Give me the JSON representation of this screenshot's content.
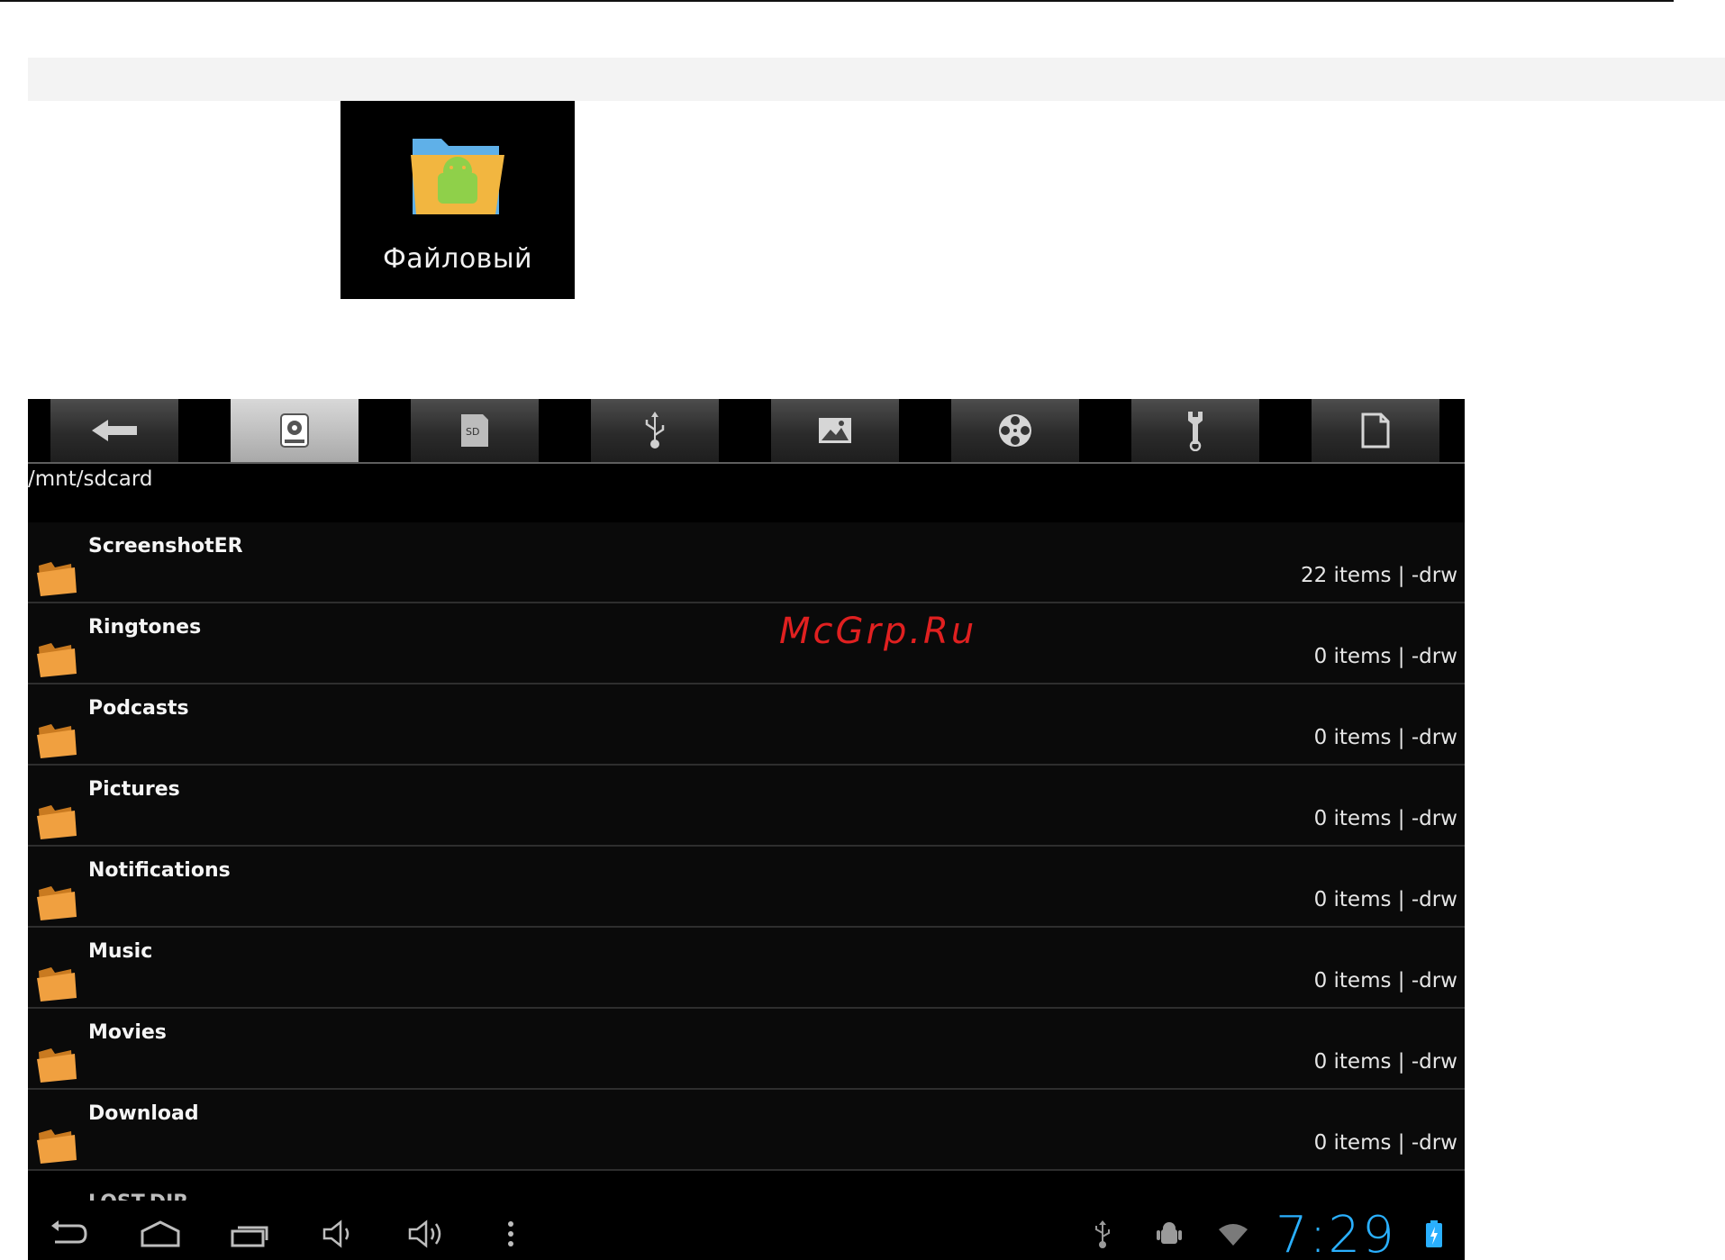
{
  "app_icon": {
    "label": "Файловый",
    "icon": "android-folder-icon"
  },
  "toolbar": {
    "buttons": [
      {
        "name": "back",
        "icon": "back-arrow-icon"
      },
      {
        "name": "internal-storage",
        "icon": "sdcard-storage-icon",
        "active": true
      },
      {
        "name": "sd",
        "icon": "sd-card-icon"
      },
      {
        "name": "usb",
        "icon": "usb-icon"
      },
      {
        "name": "images",
        "icon": "image-icon"
      },
      {
        "name": "video",
        "icon": "film-reel-icon"
      },
      {
        "name": "tools",
        "icon": "wrench-icon"
      },
      {
        "name": "document",
        "icon": "document-icon"
      }
    ]
  },
  "path": "/mnt/sdcard",
  "files": [
    {
      "name": "ScreenshotER",
      "meta": "22 items | -drw"
    },
    {
      "name": "Ringtones",
      "meta": "0 items | -drw"
    },
    {
      "name": "Podcasts",
      "meta": "0 items | -drw"
    },
    {
      "name": "Pictures",
      "meta": "0 items | -drw"
    },
    {
      "name": "Notifications",
      "meta": "0 items | -drw"
    },
    {
      "name": "Music",
      "meta": "0 items | -drw"
    },
    {
      "name": "Movies",
      "meta": "0 items | -drw"
    },
    {
      "name": "Download",
      "meta": "0 items | -drw"
    }
  ],
  "partial_row": "LOST.DIR",
  "watermark": "McGrp.Ru",
  "status_bar": {
    "time": "7:29",
    "clock_color": "#2ab0ff"
  },
  "colors": {
    "folder": "#f0a040",
    "accent": "#2ab0ff"
  }
}
